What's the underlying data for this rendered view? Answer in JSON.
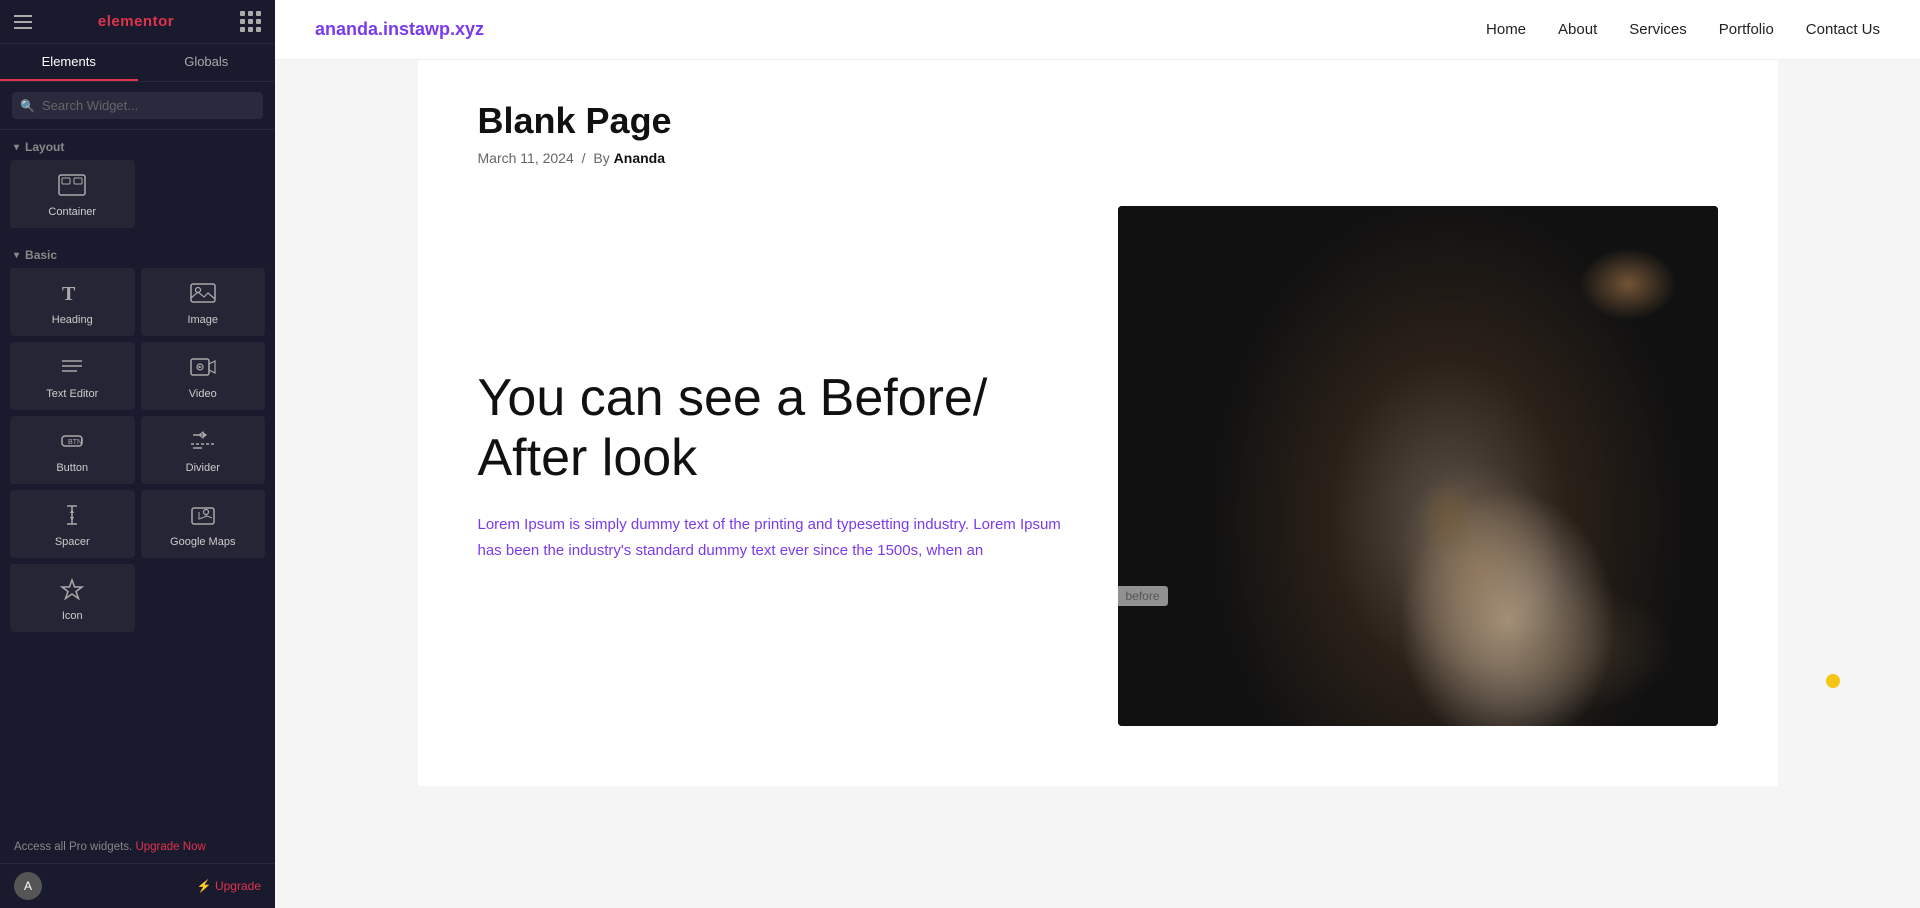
{
  "sidebar": {
    "brand": "elementor",
    "tabs": [
      {
        "id": "elements",
        "label": "Elements",
        "active": true
      },
      {
        "id": "globals",
        "label": "Globals",
        "active": false
      }
    ],
    "search": {
      "placeholder": "Search Widget..."
    },
    "sections": [
      {
        "id": "layout",
        "label": "Layout",
        "widgets": [
          {
            "id": "container",
            "label": "Container",
            "icon": "⬜"
          }
        ]
      },
      {
        "id": "basic",
        "label": "Basic",
        "widgets": [
          {
            "id": "heading",
            "label": "Heading",
            "icon": "T"
          },
          {
            "id": "image",
            "label": "Image",
            "icon": "🖼"
          },
          {
            "id": "text-editor",
            "label": "Text Editor",
            "icon": "≡"
          },
          {
            "id": "video",
            "label": "Video",
            "icon": "▶"
          },
          {
            "id": "button",
            "label": "Button",
            "icon": "⬆"
          },
          {
            "id": "divider",
            "label": "Divider",
            "icon": "÷"
          },
          {
            "id": "spacer",
            "label": "Spacer",
            "icon": "↕"
          },
          {
            "id": "google-maps",
            "label": "Google Maps",
            "icon": "📍"
          },
          {
            "id": "icon",
            "label": "Icon",
            "icon": "☆"
          }
        ]
      }
    ],
    "bottom": {
      "avatar_text": "A",
      "upgrade_label": "⚡ Upgrade"
    },
    "upgrade_notice": "Access all Pro widgets.",
    "upgrade_link_text": "Upgrade Now"
  },
  "nav": {
    "logo": "ananda.instawp.xyz",
    "links": [
      {
        "id": "home",
        "label": "Home"
      },
      {
        "id": "about",
        "label": "About"
      },
      {
        "id": "services",
        "label": "Services"
      },
      {
        "id": "portfolio",
        "label": "Portfolio"
      },
      {
        "id": "contact",
        "label": "Contact Us"
      }
    ]
  },
  "page": {
    "title": "Blank Page",
    "meta_date": "March 11, 2024",
    "meta_sep": "/",
    "meta_by": "By",
    "meta_author": "Ananda"
  },
  "content": {
    "heading": "You can see a Before/ After look",
    "body_text": "Lorem Ipsum is simply dummy text of the printing and typesetting industry. Lorem Ipsum has been the industry's standard dummy text ever since the 1500s, when an",
    "before_label": "before"
  }
}
